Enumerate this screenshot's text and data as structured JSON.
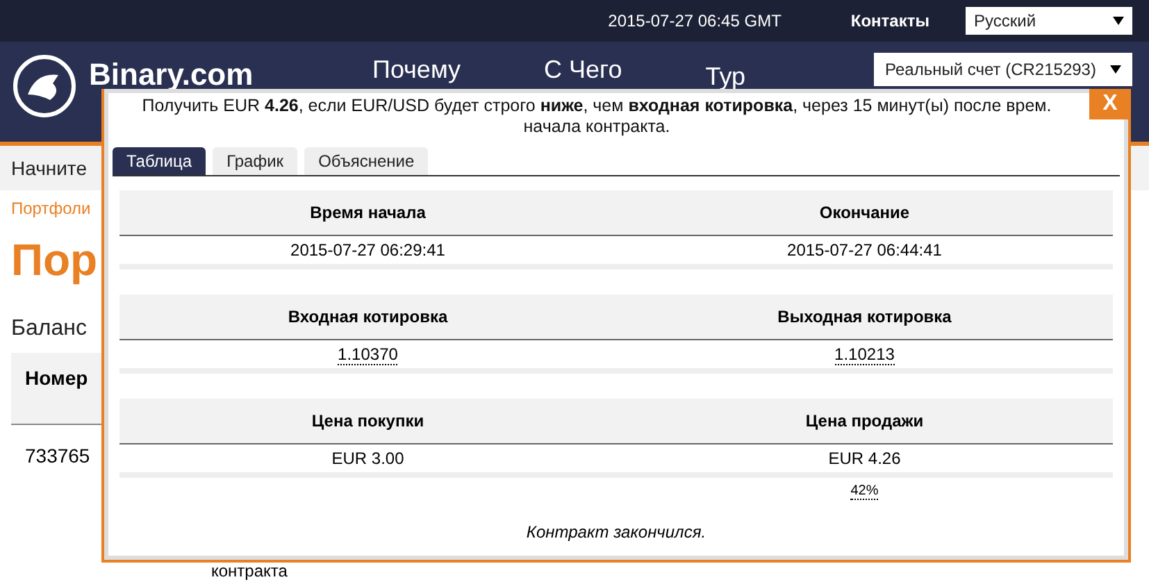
{
  "top_bar": {
    "time": "2015-07-27 06:45 GMT",
    "contacts_link": "Контакты",
    "language": "Русский"
  },
  "header": {
    "logo": "Binary.com",
    "nav": [
      "Почему",
      "С Чего",
      "Тур"
    ],
    "account": "Реальный счет (CR215293)"
  },
  "subnav": {
    "item": "Начните"
  },
  "page": {
    "breadcrumb": "Портфоли",
    "heading": "Пор",
    "balance": "Баланс",
    "table_header": "Номер",
    "row_id": "733765",
    "footer_text": "контракта"
  },
  "dialog": {
    "description": "Получить EUR **4.26**, если EUR/USD будет строго **ниже**, чем **входная котировка**, через 15 минут(ы) после врем. начала контракта.",
    "close": "X",
    "tabs": [
      {
        "label": "Таблица",
        "selected": true
      },
      {
        "label": "График",
        "selected": false
      },
      {
        "label": "Объяснение",
        "selected": false
      }
    ],
    "sections": [
      {
        "columns": [
          "Время начала",
          "Окончание"
        ],
        "values": [
          {
            "text": "2015-07-27 06:29:41",
            "dotted": false
          },
          {
            "text": "2015-07-27 06:44:41",
            "dotted": false
          }
        ]
      },
      {
        "columns": [
          "Входная котировка",
          "Выходная котировка"
        ],
        "values": [
          {
            "text": "1.10370",
            "dotted": true
          },
          {
            "text": "1.10213",
            "dotted": true
          }
        ]
      },
      {
        "columns": [
          "Цена покупки",
          "Цена продажи"
        ],
        "values": [
          {
            "text": "EUR 3.00",
            "dotted": false
          },
          {
            "text": "EUR 4.26",
            "dotted": false
          }
        ]
      }
    ],
    "profit": "42%",
    "status": "Контракт закончился."
  }
}
